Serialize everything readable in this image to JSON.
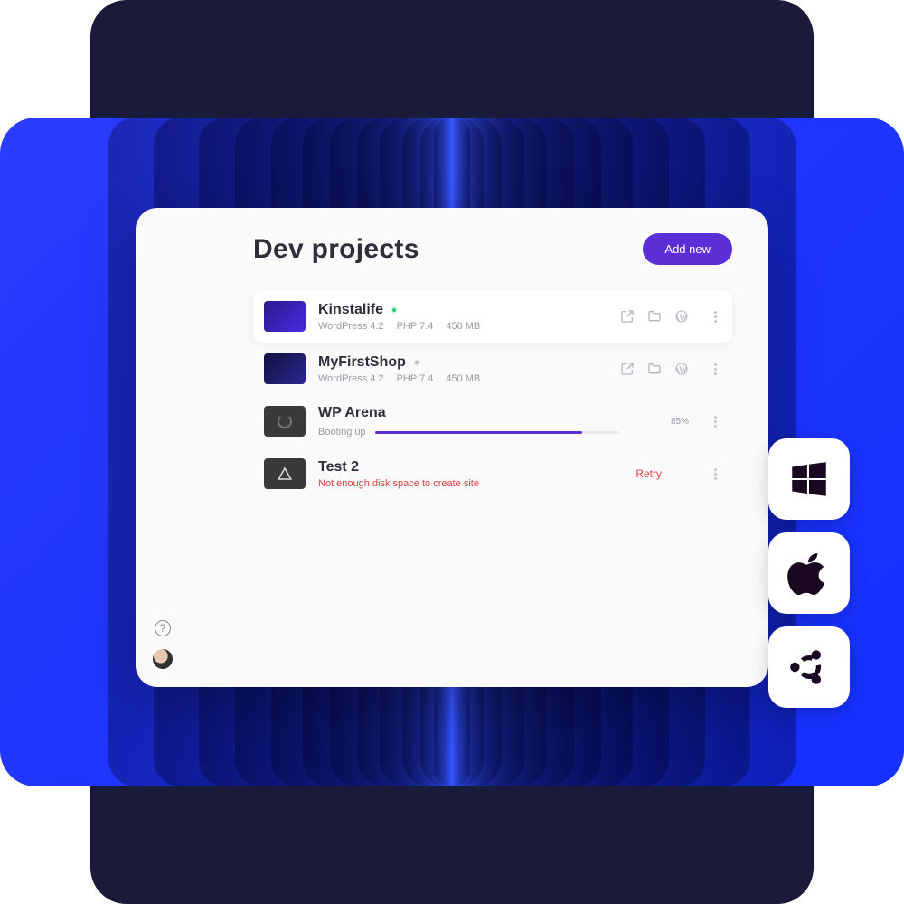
{
  "header": {
    "title": "Dev projects",
    "add_label": "Add new"
  },
  "projects": [
    {
      "name": "Kinstalife",
      "status": "running",
      "wp": "WordPress 4.2",
      "php": "PHP 7.4",
      "size": "450 MB"
    },
    {
      "name": "MyFirstShop",
      "status": "stopped",
      "wp": "WordPress 4.2",
      "php": "PHP 7.4",
      "size": "450 MB"
    },
    {
      "name": "WP Arena",
      "status": "booting",
      "boot_label": "Booting up",
      "progress": 85,
      "progress_label": "85%"
    },
    {
      "name": "Test 2",
      "status": "error",
      "error": "Not enough disk space to create site",
      "retry_label": "Retry"
    }
  ],
  "os": {
    "windows": "windows-icon",
    "apple": "apple-icon",
    "ubuntu": "ubuntu-icon"
  }
}
